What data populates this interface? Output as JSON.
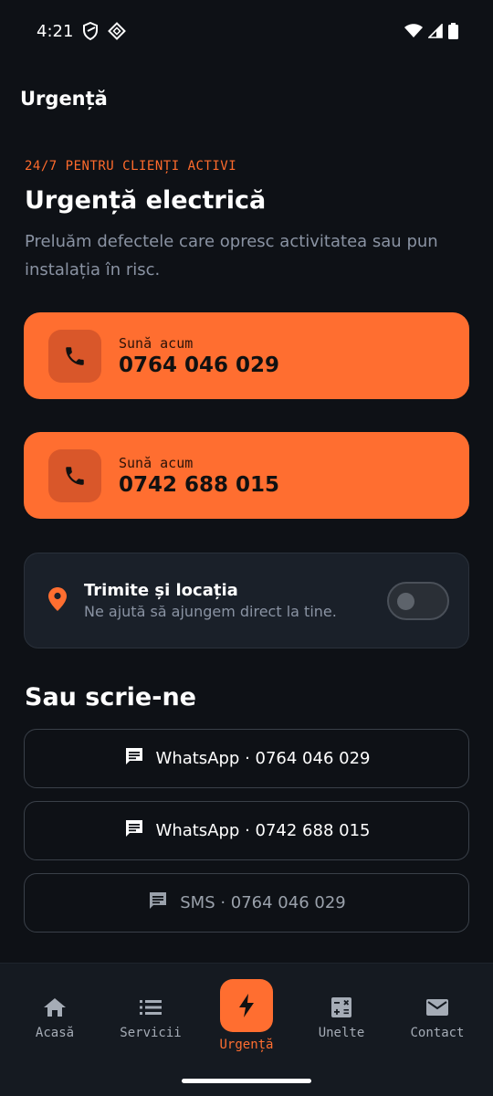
{
  "status_bar": {
    "time": "4:21",
    "icons": [
      "shield-icon",
      "vpn-icon",
      "wifi-icon",
      "signal-icon",
      "battery-icon"
    ]
  },
  "app": {
    "title": "Urgență"
  },
  "hero": {
    "eyebrow": "24/7 PENTRU CLIENȚI ACTIVI",
    "title": "Urgență electrică",
    "subtitle": "Preluăm defectele care opresc activitatea sau pun instalația în risc."
  },
  "calls": [
    {
      "label": "Sună acum",
      "number": "0764 046 029",
      "icon": "phone-icon"
    },
    {
      "label": "Sună acum",
      "number": "0742 688 015",
      "icon": "phone-icon"
    }
  ],
  "location": {
    "title": "Trimite și locația",
    "subtitle": "Ne ajută să ajungem direct la tine.",
    "enabled": false,
    "icon": "location-pin-icon"
  },
  "messages": {
    "title": "Sau scrie-ne",
    "buttons": [
      {
        "label": "WhatsApp · 0764 046 029",
        "icon": "chat-icon"
      },
      {
        "label": "WhatsApp · 0742 688 015",
        "icon": "chat-icon"
      },
      {
        "label": "SMS · 0764 046 029",
        "icon": "sms-icon"
      }
    ]
  },
  "nav": {
    "items": [
      {
        "label": "Acasă",
        "icon": "home-icon",
        "active": false
      },
      {
        "label": "Servicii",
        "icon": "list-icon",
        "active": false
      },
      {
        "label": "Urgență",
        "icon": "bolt-icon",
        "active": true
      },
      {
        "label": "Unelte",
        "icon": "calculator-icon",
        "active": false
      },
      {
        "label": "Contact",
        "icon": "mail-icon",
        "active": false
      }
    ]
  },
  "colors": {
    "accent": "#ff6e30",
    "background": "#0e1116",
    "muted_text": "#8a93a3"
  }
}
